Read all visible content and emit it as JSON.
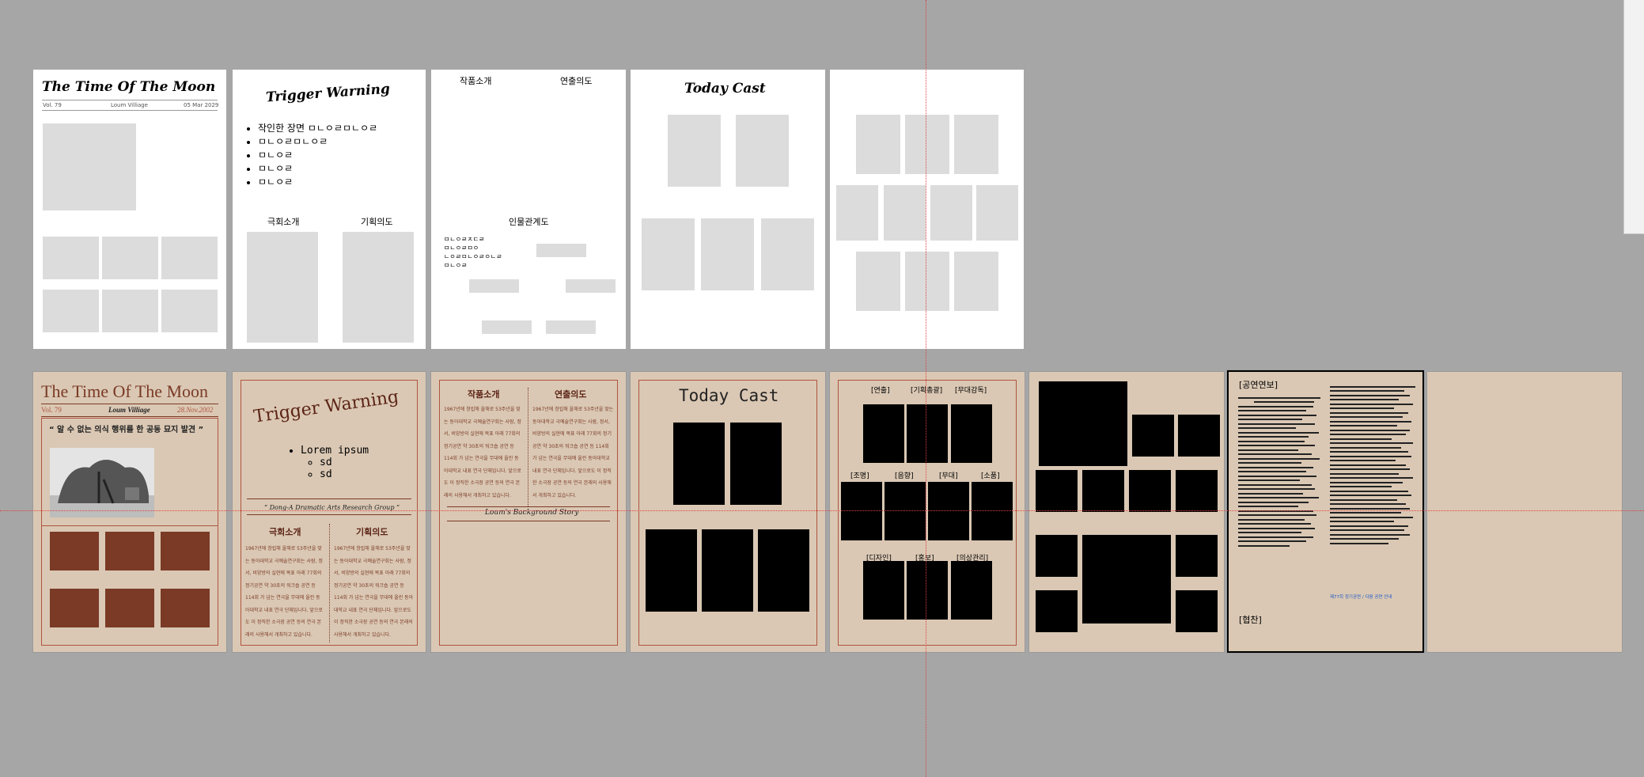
{
  "row1": {
    "p1": {
      "title": "The Time Of The Moon",
      "vol": "Vol. 79",
      "village": "Loum Villiage",
      "date": "05 Mar 2029"
    },
    "p2": {
      "title": "Trigger Warning",
      "bullets": [
        "작인한 장면 ㅁㄴㅇㄹㅁㄴㅇㄹ",
        "ㅁㄴㅇㄹㅁㄴㅇㄹ",
        "ㅁㄴㅇㄹ",
        "ㅁㄴㅇㄹ",
        "ㅁㄴㅇㄹ"
      ],
      "col1": "극회소개",
      "col2": "기획의도"
    },
    "p3": {
      "col1": "작품소개",
      "col2": "연출의도",
      "relation": "인물관계도",
      "notes": [
        "ㅁㄴㅇㄹㅈㄷㄹ",
        "ㅁㄴㅇㄹㅁㅇ",
        "ㄴㅇㄹㅁㄴㅇㄹㅇㄴㄹ",
        "ㅁㄴㅇㄹ"
      ]
    },
    "p4": {
      "title": "Today Cast"
    }
  },
  "row2": {
    "p1": {
      "title": "The Time Of The Moon",
      "vol": "Vol. 79",
      "village": "Loum Villiage",
      "date": "28.Nov.2002",
      "headline": "“ 알 수 없는 의식 행위를 한 공동 묘지 발견 ”"
    },
    "p2": {
      "title": "Trigger Warning",
      "bullets": [
        "Lorem ipsum",
        "sd",
        "sd"
      ],
      "subtitle": "“ Dong-A Dramatic Arts Research Group ”",
      "col1": "극회소개",
      "col2": "기획의도",
      "body": "1967년에 창립해 올해로 53주년을 맞는 동아대학교 극예술연구회는 사람, 정서, 비양방의 실현에 목표 아래 77회의 정기공연 약 30초의 워크숍 공연 등 114회 가 넘는 연극을 무대에 올린 동아대학교 내표 연극 단체입니다. 앞으로도 이 정직한 소극장 공연 등의 연극 본래의 사용해서 개최하고 있습니다."
    },
    "p3": {
      "col1": "작품소개",
      "col2": "연출의도",
      "caption": "Loum's Background Story",
      "body": "1967년에 창립해 올해로 53주년을 맞는 동아대학교 극예술연구회는 사람, 정서, 비양방의 실현에 목표 아래 77회의 정기공연 약 30초의 워크숍 공연 등 114회 가 넘는 연극을 무대에 올린 동아대학교 내표 연극 단체입니다. 앞으로도 이 정직한 소극장 공연 등의 연극 본래의 사용해서 개최하고 있습니다."
    },
    "p4": {
      "title": "Today Cast"
    },
    "p5": {
      "labels": [
        "[연출]",
        "[기획총괄]",
        "[무대감독]",
        "[조명]",
        "[음향]",
        "[무대]",
        "[소품]",
        "[디자인]",
        "[홍보]",
        "[의상관리]"
      ]
    },
    "p7": {
      "heading": "[공연연보]",
      "footer_note": "제77회 정기공연 / 다음 공연 안내",
      "sponsor": "[협찬]"
    }
  },
  "colors": {
    "canvas": "#a6a6a6",
    "beige": "#dac8b4",
    "brown": "#7a3a26",
    "frame": "#b0553e",
    "guide": "#e04040"
  }
}
